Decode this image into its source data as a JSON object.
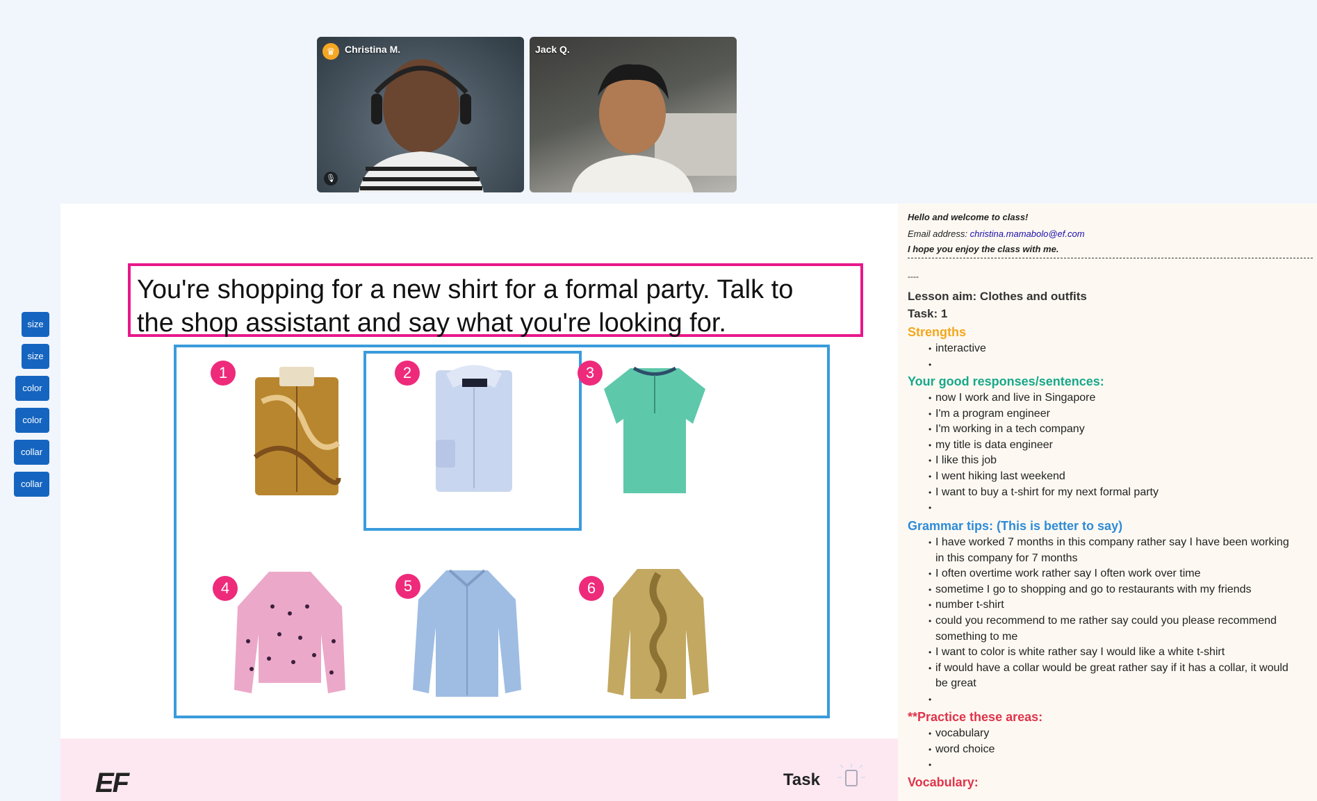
{
  "participants": [
    {
      "name": "Christina M.",
      "host": true,
      "mic_icon": "mic-icon"
    },
    {
      "name": "Jack Q.",
      "host": false
    }
  ],
  "toolbar": {
    "buttons": [
      "size",
      "size",
      "color",
      "color",
      "collar",
      "collar"
    ]
  },
  "slide": {
    "prompt": "You're shopping for a new shirt for a formal party. Talk to the shop assistant and say what you're looking for.",
    "items": [
      "1",
      "2",
      "3",
      "4",
      "5",
      "6"
    ],
    "logo": "EF",
    "footer_label": "Task"
  },
  "notes": {
    "greeting": "Hello and welcome to class!",
    "email_label": "Email address:",
    "email": "christina.mamabolo@ef.com",
    "enjoy": "I hope you enjoy the class with me.",
    "dashes_tail": "----",
    "lesson_aim": "Lesson aim:  Clothes and outfits",
    "task": "Task: 1",
    "strengths_title": "Strengths",
    "strengths": [
      "interactive",
      ""
    ],
    "good_title": "Your good responses/sentences:",
    "good": [
      "now I work and live in Singapore",
      "I'm a program engineer",
      "I'm working in a tech company",
      "my title is data engineer",
      "I like this job",
      "I went hiking last weekend",
      "I want to buy a t-shirt for my next formal party",
      ""
    ],
    "grammar_title": "Grammar tips: (This is better to say)",
    "grammar": [
      "I have worked 7 months in this company rather say I have been working in this company for 7 months",
      "I often overtime work rather say I often work over time",
      "sometime I go to shopping and go to restaurants with my friends",
      "number t-shirt",
      "could you recommend to me rather say could you please recommend something to me",
      "I want to color is white rather say I would like a white t-shirt",
      "if would have a collar would be great rather say if it has a collar, it would be great",
      ""
    ],
    "practice_title": "**Practice these areas:",
    "practice": [
      "vocabulary",
      "word choice",
      ""
    ],
    "vocab_title": "Vocabulary:"
  }
}
